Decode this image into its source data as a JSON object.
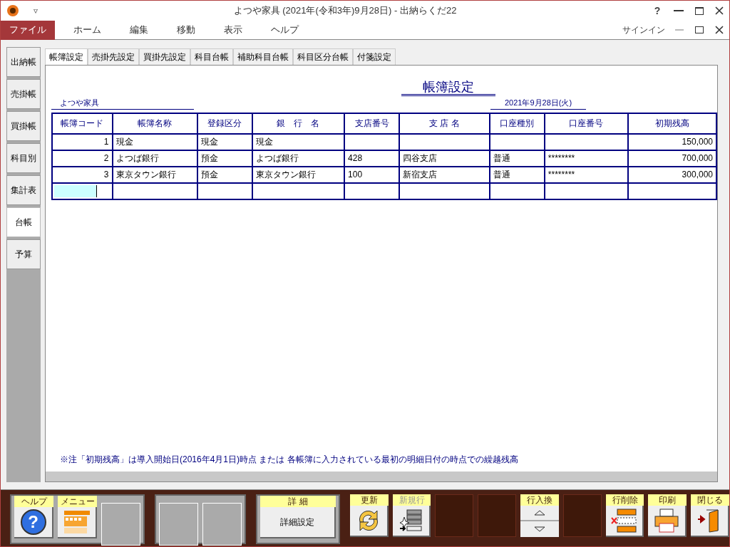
{
  "window": {
    "title": "よつや家具 (2021年(令和3年)9月28日) - 出納らくだ22",
    "signin": "サインイン",
    "quick_access": "▿",
    "help": "?"
  },
  "menu": [
    {
      "label": "ファイル",
      "selected": true
    },
    {
      "label": "ホーム",
      "selected": false
    },
    {
      "label": "編集",
      "selected": false
    },
    {
      "label": "移動",
      "selected": false
    },
    {
      "label": "表示",
      "selected": false
    },
    {
      "label": "ヘルプ",
      "selected": false
    }
  ],
  "side_tabs": [
    {
      "label": "出納帳",
      "selected": false
    },
    {
      "label": "売掛帳",
      "selected": false
    },
    {
      "label": "買掛帳",
      "selected": false
    },
    {
      "label": "科目別",
      "selected": false
    },
    {
      "label": "集計表",
      "selected": false
    },
    {
      "label": "台帳",
      "selected": true
    },
    {
      "label": "予算",
      "selected": false
    }
  ],
  "tabs": [
    {
      "label": "帳簿設定",
      "selected": true
    },
    {
      "label": "売掛先設定",
      "selected": false
    },
    {
      "label": "買掛先設定",
      "selected": false
    },
    {
      "label": "科目台帳",
      "selected": false
    },
    {
      "label": "補助科目台帳",
      "selected": false
    },
    {
      "label": "科目区分台帳",
      "selected": false
    },
    {
      "label": "付箋設定",
      "selected": false
    }
  ],
  "form": {
    "title": "帳簿設定",
    "company": "よつや家具",
    "date": "2021年9月28日(火)",
    "table": {
      "columns": [
        "帳簿コード",
        "帳簿名称",
        "登録区分",
        "銀　行　名",
        "支店番号",
        "支 店 名",
        "口座種別",
        "口座番号",
        "初期残高"
      ],
      "rows": [
        [
          "1",
          "現金",
          "現金",
          "現金",
          "",
          "",
          "",
          "",
          "150,000"
        ],
        [
          "2",
          "よつば銀行",
          "預金",
          "よつば銀行",
          "428",
          "四谷支店",
          "普通",
          "********",
          "700,000"
        ],
        [
          "3",
          "東京タウン銀行",
          "預金",
          "東京タウン銀行",
          "100",
          "新宿支店",
          "普通",
          "********",
          "300,000"
        ]
      ]
    },
    "note": "※注「初期残高」は導入開始日(2016年4月1日)時点 または 各帳簿に入力されている最初の明細日付の時点での繰越残高"
  },
  "toolbar": [
    {
      "kind": "help",
      "label": "ヘルプ",
      "glyph": "?",
      "disabled": false
    },
    {
      "kind": "menu",
      "label": "メニュー",
      "disabled": false
    },
    {
      "kind": "slot"
    },
    {
      "kind": "slot"
    },
    {
      "kind": "slot"
    },
    {
      "kind": "text",
      "label": "詳 細",
      "text": "詳細設定",
      "disabled": false
    },
    {
      "kind": "refresh",
      "label": "更新",
      "disabled": false
    },
    {
      "kind": "newrow",
      "label": "新規行",
      "disabled": true
    },
    {
      "kind": "dark"
    },
    {
      "kind": "dark"
    },
    {
      "kind": "swap",
      "label": "行入換",
      "disabled": false
    },
    {
      "kind": "dark"
    },
    {
      "kind": "deleterow",
      "label": "行削除",
      "disabled": false
    },
    {
      "kind": "print",
      "label": "印刷",
      "disabled": false
    },
    {
      "kind": "exit",
      "label": "閉じる",
      "disabled": false
    }
  ]
}
